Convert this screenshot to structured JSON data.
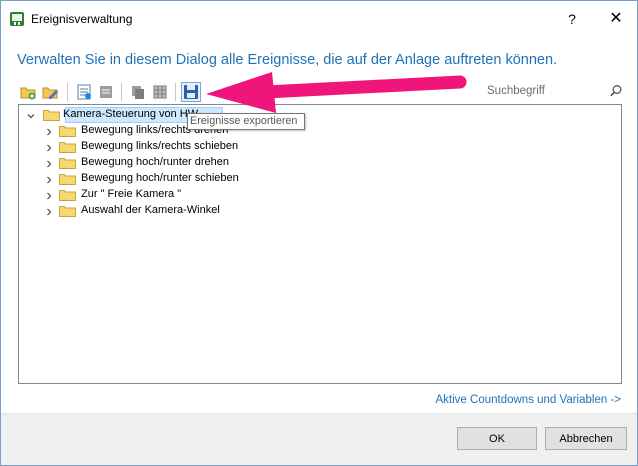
{
  "window": {
    "title": "Ereignisverwaltung",
    "help_label": "?",
    "close_label": "✕"
  },
  "headline": "Verwalten Sie in diesem Dialog alle Ereignisse, die auf der Anlage auftreten können.",
  "toolbar": {
    "tooltip": "Ereignisse exportieren",
    "buttons": [
      "new-folder-icon",
      "edit-icon",
      "properties-icon",
      "notes-icon",
      "copy-icon",
      "table-icon",
      "save-icon"
    ]
  },
  "search": {
    "placeholder": "Suchbegriff"
  },
  "tree": {
    "root": "Kamera-Steuerung von HW",
    "children": [
      "Bewegung links/rechts drehen",
      "Bewegung links/rechts schieben",
      "Bewegung hoch/runter drehen",
      "Bewegung hoch/runter schieben",
      "Zur \" Freie Kamera \"",
      "Auswahl der Kamera-Winkel"
    ]
  },
  "link": "Aktive Countdowns und Variablen ->",
  "buttons": {
    "ok": "OK",
    "cancel": "Abbrechen"
  },
  "colors": {
    "accent": "#1e72b8",
    "arrow": "#f0157a",
    "selection": "#cde8ff"
  }
}
